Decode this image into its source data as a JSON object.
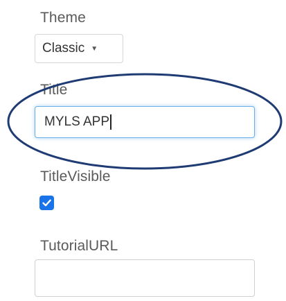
{
  "properties": {
    "theme": {
      "label": "Theme",
      "value": "Classic"
    },
    "title": {
      "label": "Title",
      "value": "MYLS APP"
    },
    "title_visible": {
      "label": "TitleVisible",
      "checked": true
    },
    "tutorial_url": {
      "label": "TutorialURL",
      "value": ""
    }
  },
  "colors": {
    "checkbox": "#1a73e8",
    "focus_border": "#66afe9",
    "annotation_ellipse": "#1f3b73"
  },
  "icons": {
    "dropdown_caret": "caret-down-icon",
    "checkbox_mark": "checkmark-icon"
  }
}
